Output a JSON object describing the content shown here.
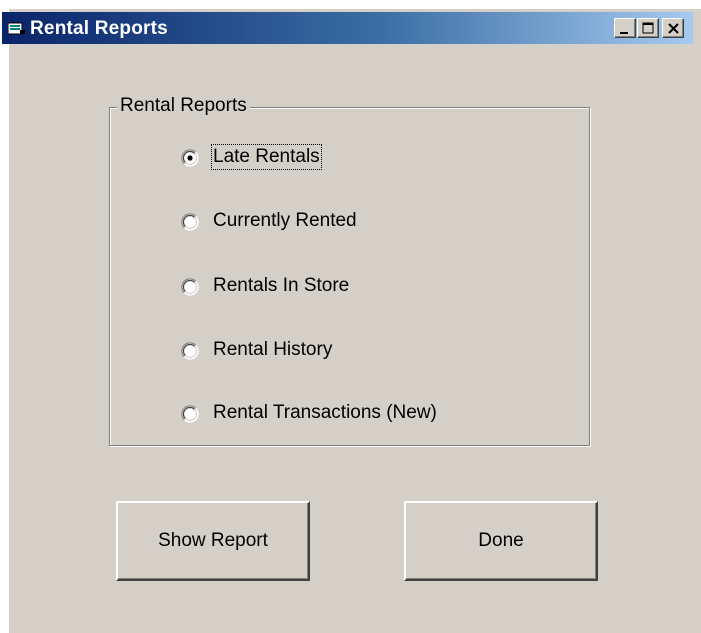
{
  "window": {
    "title": "Rental Reports",
    "controls": {
      "minimize": "minimize",
      "maximize": "maximize",
      "close": "close"
    }
  },
  "group": {
    "legend": "Rental Reports",
    "options": [
      {
        "label": "Late Rentals",
        "selected": true
      },
      {
        "label": "Currently Rented",
        "selected": false
      },
      {
        "label": "Rentals In Store",
        "selected": false
      },
      {
        "label": "Rental History",
        "selected": false
      },
      {
        "label": "Rental Transactions (New)",
        "selected": false
      }
    ]
  },
  "buttons": {
    "show_report": "Show Report",
    "done": "Done"
  },
  "colors": {
    "face": "#d4d0c8",
    "title_start": "#0a246a",
    "title_end": "#a6caf0"
  }
}
